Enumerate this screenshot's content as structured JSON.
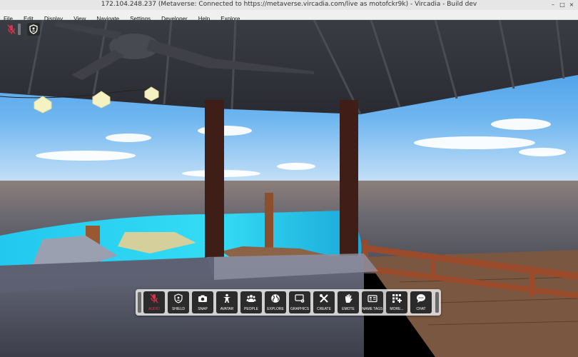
{
  "window": {
    "title": "172.104.248.237 (Metaverse: Connected to https://metaverse.vircadia.com/live as motofckr9k) - Vircadia - Build dev",
    "controls": {
      "minimize": "–",
      "maximize": "□",
      "close": "×"
    }
  },
  "menubar": {
    "items": [
      "File",
      "Edit",
      "Display",
      "View",
      "Navigate",
      "Settings",
      "Developer",
      "Help",
      "Explore"
    ]
  },
  "hud": {
    "audio_icon": "muted-microphone-icon",
    "shield_icon": "shield-icon"
  },
  "toolbar": {
    "buttons": [
      {
        "label": "AUDIO",
        "icon": "microphone-muted-icon",
        "accent": "#d9324a"
      },
      {
        "label": "SHIELD",
        "icon": "shield-icon"
      },
      {
        "label": "SNAP",
        "icon": "camera-icon"
      },
      {
        "label": "AVATAR",
        "icon": "person-icon"
      },
      {
        "label": "PEOPLE",
        "icon": "people-icon"
      },
      {
        "label": "EXPLORE",
        "icon": "globe-icon"
      },
      {
        "label": "GRAPHICS",
        "icon": "display-gear-icon"
      },
      {
        "label": "CREATE",
        "icon": "tools-icon"
      },
      {
        "label": "EMOTE",
        "icon": "hand-icon"
      },
      {
        "label": "NAME TAGS",
        "icon": "id-card-icon"
      },
      {
        "label": "MORE...",
        "icon": "grid-plus-icon"
      },
      {
        "label": "CHAT",
        "icon": "speech-bubble-icon"
      }
    ]
  },
  "colors": {
    "audio_accent": "#d9324a",
    "toolbar_button": "#2b2b2b",
    "toolbar_bg": "#e0e0e0"
  }
}
